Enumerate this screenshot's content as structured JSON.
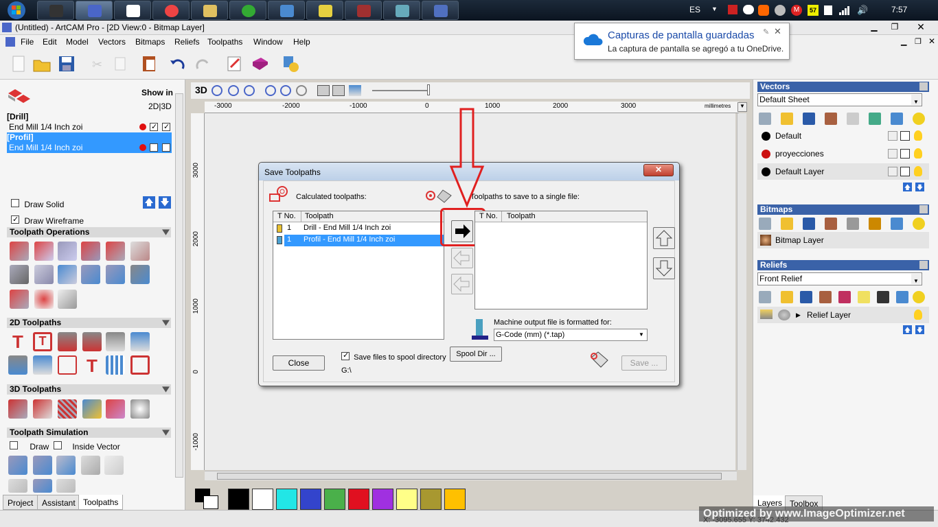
{
  "taskbar": {
    "language": "ES",
    "clock": "7:57",
    "badge_57": "57"
  },
  "window": {
    "title": "(Untitled) - ArtCAM Pro - [2D View:0 - Bitmap Layer]"
  },
  "menu": [
    "File",
    "Edit",
    "Model",
    "Vectors",
    "Bitmaps",
    "Reliefs",
    "Toolpaths",
    "Window",
    "Help"
  ],
  "notification": {
    "title": "Capturas de pantalla guardadas",
    "body": "La captura de pantalla se agregó a tu OneDrive."
  },
  "left_panel": {
    "show_in": "Show in",
    "show_in_modes": "2D|3D",
    "groups": [
      {
        "name": "[Drill]",
        "tool": "End Mill 1/4 Inch zoi"
      },
      {
        "name": "[Profil]",
        "tool": "End Mill 1/4 Inch zoi"
      }
    ],
    "draw_solid": "Draw Solid",
    "draw_wireframe": "Draw Wireframe",
    "sections": {
      "ops": "Toolpath Operations",
      "toolpaths2d": "2D Toolpaths",
      "toolpaths3d": "3D Toolpaths",
      "sim": "Toolpath Simulation"
    },
    "sim_draw": "Draw",
    "sim_inside": "Inside Vector",
    "tabs": [
      "Project",
      "Assistant",
      "Toolpaths"
    ]
  },
  "view": {
    "mode": "3D",
    "ruler_units": "millimetres",
    "h_ticks": [
      "-3000",
      "-2000",
      "-1000",
      "0",
      "1000",
      "2000",
      "3000"
    ],
    "v_ticks": [
      "3000",
      "2000",
      "1000",
      "0",
      "-1000"
    ]
  },
  "dialog": {
    "title": "Save Toolpaths",
    "calc_label": "Calculated toolpaths:",
    "save_label": "Toolpaths to save to a single file:",
    "col_tno": "T No.",
    "col_toolpath": "Toolpath",
    "rows": [
      {
        "tno": "1",
        "name": "Drill - End Mill 1/4 Inch zoi"
      },
      {
        "tno": "1",
        "name": "Profil - End Mill 1/4 Inch zoi"
      }
    ],
    "machine_label": "Machine output file is formatted for:",
    "format": "G-Code (mm) (*.tap)",
    "close": "Close",
    "spool_checkbox": "Save files to spool directory",
    "spool_dir_btn": "Spool Dir ...",
    "spool_path": "G:\\",
    "save": "Save ..."
  },
  "right_panel": {
    "vectors": {
      "title": "Vectors",
      "sheet": "Default Sheet",
      "layers": [
        {
          "name": "Default",
          "color": "#000000"
        },
        {
          "name": "proyecciones",
          "color": "#cc1111"
        },
        {
          "name": "Default Layer",
          "color": "#000000"
        }
      ]
    },
    "bitmaps": {
      "title": "Bitmaps",
      "layer": "Bitmap Layer"
    },
    "reliefs": {
      "title": "Reliefs",
      "relief": "Front Relief",
      "layer": "Relief Layer"
    },
    "tabs": [
      "Layers",
      "Toolbox"
    ]
  },
  "palette": [
    "#000000",
    "#ffffff",
    "#22e6e6",
    "#3344cc",
    "#4ab04a",
    "#e01020",
    "#a030e0",
    "#ffff88",
    "#a89830",
    "#ffc000"
  ],
  "status": {
    "coords": "X: -3095.655  Y: 3742.432",
    "watermark": "Optimized by www.ImageOptimizer.net"
  }
}
